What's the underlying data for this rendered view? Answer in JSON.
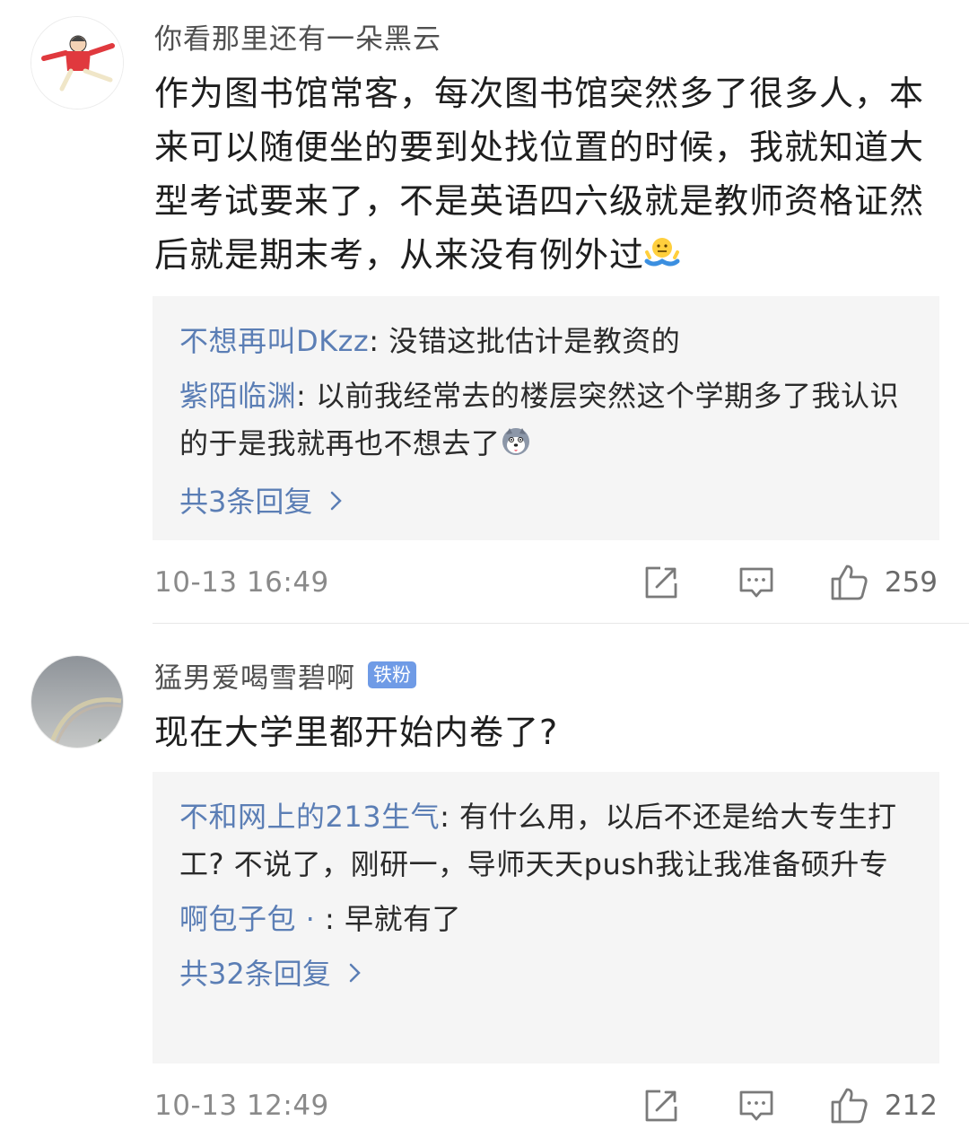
{
  "comments": [
    {
      "author": "你看那里还有一朵黑云",
      "badge": "",
      "avatar_icon": "stick-figure-avatar",
      "text": "作为图书馆常客，每次图书馆突然多了很多人，本来可以随便坐的要到处找位置的时候，我就知道大型考试要来了，不是英语四六级就是教师资格证然后就是期末考，从来没有例外过",
      "text_emoji": "shrug-emoji",
      "replies": [
        {
          "name": "不想再叫DKzz",
          "sep": ": ",
          "text": "没错这批估计是教资的"
        },
        {
          "name": "紫陌临渊",
          "sep": ": ",
          "text": "以前我经常去的楼层突然这个学期多了我认识的于是我就再也不想去了"
        }
      ],
      "more": "共3条回复",
      "time": "10-13 16:49",
      "likes": "259"
    },
    {
      "author": "猛男爱喝雪碧啊",
      "badge": "铁粉",
      "avatar_icon": "sky-rainbow-avatar",
      "text": "现在大学里都开始内卷了?",
      "replies": [
        {
          "name": "不和网上的213生气",
          "sep": ": ",
          "text": "有什么用，以后不还是给大专生打工? 不说了，刚研一，导师天天push我让我准备硕升专"
        },
        {
          "name": "啊包子包 · ",
          "sep": ": ",
          "text": "早就有了"
        }
      ],
      "more": "共32条回复",
      "time": "10-13 12:49",
      "likes": "212"
    }
  ],
  "colors": {
    "link": "#5b7eb5",
    "badge": "#6f9be6",
    "reply_bg": "#f5f5f5"
  }
}
